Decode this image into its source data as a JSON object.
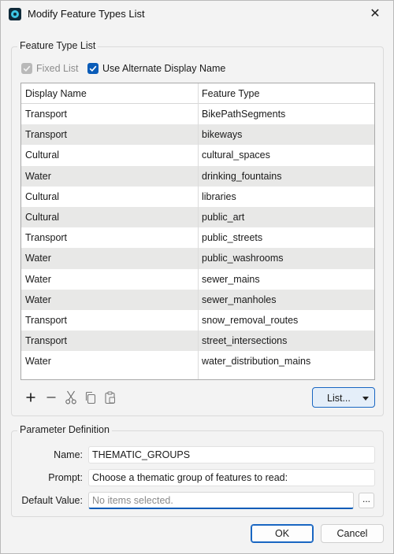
{
  "window": {
    "title": "Modify Feature Types List"
  },
  "feature_group": {
    "legend": "Feature Type List",
    "fixed_list": {
      "label": "Fixed List",
      "checked": true,
      "disabled": true
    },
    "use_alternate": {
      "label": "Use Alternate Display Name",
      "checked": true
    }
  },
  "table": {
    "columns": [
      "Display Name",
      "Feature Type"
    ],
    "rows": [
      [
        "Transport",
        "BikePathSegments"
      ],
      [
        "Transport",
        "bikeways"
      ],
      [
        "Cultural",
        "cultural_spaces"
      ],
      [
        "Water",
        "drinking_fountains"
      ],
      [
        "Cultural",
        "libraries"
      ],
      [
        "Cultural",
        "public_art"
      ],
      [
        "Transport",
        "public_streets"
      ],
      [
        "Water",
        "public_washrooms"
      ],
      [
        "Water",
        "sewer_mains"
      ],
      [
        "Water",
        "sewer_manholes"
      ],
      [
        "Transport",
        "snow_removal_routes"
      ],
      [
        "Transport",
        "street_intersections"
      ],
      [
        "Water",
        "water_distribution_mains"
      ]
    ]
  },
  "toolbar": {
    "icons": [
      "add-icon",
      "remove-icon",
      "cut-icon",
      "copy-icon",
      "paste-icon"
    ],
    "list_button": "List..."
  },
  "param_group": {
    "legend": "Parameter Definition",
    "name_label": "Name:",
    "name_value": "THEMATIC_GROUPS",
    "prompt_label": "Prompt:",
    "prompt_value": "Choose a thematic group of features to read:",
    "default_label": "Default Value:",
    "default_placeholder": "No items selected.",
    "browse_label": "..."
  },
  "buttons": {
    "ok": "OK",
    "cancel": "Cancel"
  },
  "colors": {
    "accent": "#0a5cb8",
    "alt_row": "#e8e8e7"
  }
}
